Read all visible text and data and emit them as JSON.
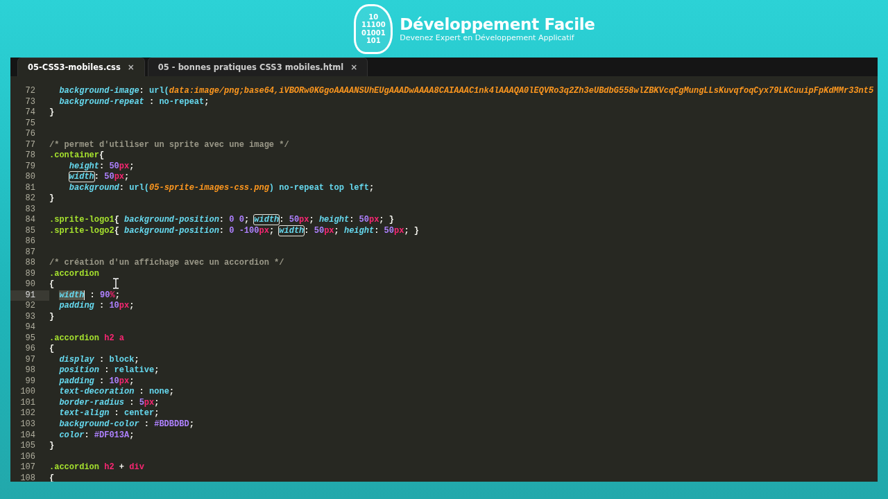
{
  "brand": {
    "logo_digits": "10\n11100\n01001\n101",
    "title": "Développement Facile",
    "tagline": "Devenez Expert en Développement Applicatif"
  },
  "tabs": [
    {
      "label": "05-CSS3-mobiles.css",
      "close": "×",
      "selected": true
    },
    {
      "label": "05 - bonnes pratiques CSS3 mobiles.html",
      "close": "×",
      "selected": false
    }
  ],
  "lines": [
    {
      "number": "72",
      "kind": "decl",
      "current": false,
      "tokens": [
        {
          "kind": "prop",
          "text": "background-image"
        },
        {
          "kind": "p",
          "text": ": "
        },
        {
          "kind": "val",
          "text": "url("
        },
        {
          "kind": "str",
          "text": "data:image/png;base64,iVBORw0KGgoAAAANSUhEUgAAADwAAAA8CAIAAAC1nk4lAAAQA0lEQVRo3q2Zh3eUBdbG558wlZBKVcqCgMungLLsKuvqfoqCyx79LKCuuipFpKdMMr33nt5"
        }
      ]
    },
    {
      "number": "73",
      "kind": "decl",
      "current": false,
      "tokens": [
        {
          "kind": "prop",
          "text": "background-repeat"
        },
        {
          "kind": "p",
          "text": " : "
        },
        {
          "kind": "val",
          "text": "no-repeat"
        },
        {
          "kind": "p",
          "text": ";"
        }
      ]
    },
    {
      "number": "74",
      "kind": "rule",
      "current": false,
      "tokens": [
        {
          "kind": "p",
          "text": "}"
        }
      ]
    },
    {
      "number": "75",
      "current": false
    },
    {
      "number": "76",
      "current": false
    },
    {
      "number": "77",
      "kind": "rule",
      "current": false,
      "tokens": [
        {
          "kind": "com",
          "text": "/* permet d'utiliser un sprite avec une image */"
        }
      ]
    },
    {
      "number": "78",
      "kind": "rule",
      "current": false,
      "tokens": [
        {
          "kind": "sel",
          "text": ".container"
        },
        {
          "kind": "p",
          "text": "{"
        }
      ]
    },
    {
      "number": "79",
      "kind": "nested",
      "current": false,
      "tokens": [
        {
          "kind": "prop",
          "text": "height"
        },
        {
          "kind": "p",
          "text": ": "
        },
        {
          "kind": "num",
          "text": "50"
        },
        {
          "kind": "unit",
          "text": "px"
        },
        {
          "kind": "p",
          "text": ";"
        }
      ]
    },
    {
      "number": "80",
      "kind": "nested",
      "current": false,
      "tokens": [
        {
          "kind": "prop",
          "text": "width",
          "boxed": true
        },
        {
          "kind": "p",
          "text": ": "
        },
        {
          "kind": "num",
          "text": "50"
        },
        {
          "kind": "unit",
          "text": "px"
        },
        {
          "kind": "p",
          "text": ";"
        }
      ]
    },
    {
      "number": "81",
      "kind": "nested",
      "current": false,
      "tokens": [
        {
          "kind": "prop",
          "text": "background"
        },
        {
          "kind": "p",
          "text": ": "
        },
        {
          "kind": "val",
          "text": "url("
        },
        {
          "kind": "str",
          "text": "05-sprite-images-css.png"
        },
        {
          "kind": "val",
          "text": ") no-repeat top left"
        },
        {
          "kind": "p",
          "text": ";"
        }
      ]
    },
    {
      "number": "82",
      "kind": "rule",
      "current": false,
      "tokens": [
        {
          "kind": "p",
          "text": "}"
        }
      ]
    },
    {
      "number": "83",
      "current": false
    },
    {
      "number": "84",
      "kind": "rule",
      "current": false,
      "tokens": [
        {
          "kind": "sel",
          "text": ".sprite-logo1"
        },
        {
          "kind": "p",
          "text": "{ "
        },
        {
          "kind": "prop",
          "text": "background-position"
        },
        {
          "kind": "p",
          "text": ": "
        },
        {
          "kind": "num",
          "text": "0 0"
        },
        {
          "kind": "p",
          "text": "; "
        },
        {
          "kind": "prop",
          "text": "width",
          "boxed": true
        },
        {
          "kind": "p",
          "text": ": "
        },
        {
          "kind": "num",
          "text": "50"
        },
        {
          "kind": "unit",
          "text": "px"
        },
        {
          "kind": "p",
          "text": "; "
        },
        {
          "kind": "prop",
          "text": "height"
        },
        {
          "kind": "p",
          "text": ": "
        },
        {
          "kind": "num",
          "text": "50"
        },
        {
          "kind": "unit",
          "text": "px"
        },
        {
          "kind": "p",
          "text": "; }"
        }
      ]
    },
    {
      "number": "85",
      "kind": "rule",
      "current": false,
      "tokens": [
        {
          "kind": "sel",
          "text": ".sprite-logo2"
        },
        {
          "kind": "p",
          "text": "{ "
        },
        {
          "kind": "prop",
          "text": "background-position"
        },
        {
          "kind": "p",
          "text": ": "
        },
        {
          "kind": "num",
          "text": "0 -100"
        },
        {
          "kind": "unit",
          "text": "px"
        },
        {
          "kind": "p",
          "text": "; "
        },
        {
          "kind": "prop",
          "text": "width",
          "boxed": true
        },
        {
          "kind": "p",
          "text": ": "
        },
        {
          "kind": "num",
          "text": "50"
        },
        {
          "kind": "unit",
          "text": "px"
        },
        {
          "kind": "p",
          "text": "; "
        },
        {
          "kind": "prop",
          "text": "height"
        },
        {
          "kind": "p",
          "text": ": "
        },
        {
          "kind": "num",
          "text": "50"
        },
        {
          "kind": "unit",
          "text": "px"
        },
        {
          "kind": "p",
          "text": "; }"
        }
      ]
    },
    {
      "number": "86",
      "current": false
    },
    {
      "number": "87",
      "current": false
    },
    {
      "number": "88",
      "kind": "rule",
      "current": false,
      "tokens": [
        {
          "kind": "com",
          "text": "/* création d'un affichage avec un accordion */"
        }
      ]
    },
    {
      "number": "89",
      "kind": "rule",
      "current": false,
      "tokens": [
        {
          "kind": "sel",
          "text": ".accordion"
        }
      ]
    },
    {
      "number": "90",
      "kind": "rule",
      "current": false,
      "tokens": [
        {
          "kind": "p",
          "text": "{"
        }
      ]
    },
    {
      "number": "91",
      "kind": "decl",
      "current": true,
      "tokens": [
        {
          "kind": "prop",
          "text": "width",
          "selected": true
        },
        {
          "kind": "p",
          "text": " : "
        },
        {
          "kind": "num",
          "text": "90"
        },
        {
          "kind": "unit",
          "text": "%"
        },
        {
          "kind": "p",
          "text": ";"
        }
      ]
    },
    {
      "number": "92",
      "kind": "decl",
      "current": false,
      "tokens": [
        {
          "kind": "prop",
          "text": "padding"
        },
        {
          "kind": "p",
          "text": " : "
        },
        {
          "kind": "num",
          "text": "10"
        },
        {
          "kind": "unit",
          "text": "px"
        },
        {
          "kind": "p",
          "text": ";"
        }
      ]
    },
    {
      "number": "93",
      "kind": "rule",
      "current": false,
      "tokens": [
        {
          "kind": "p",
          "text": "}"
        }
      ]
    },
    {
      "number": "94",
      "current": false
    },
    {
      "number": "95",
      "kind": "rule",
      "current": false,
      "tokens": [
        {
          "kind": "sel",
          "text": ".accordion "
        },
        {
          "kind": "tag",
          "text": "h2 a"
        }
      ]
    },
    {
      "number": "96",
      "kind": "rule",
      "current": false,
      "tokens": [
        {
          "kind": "p",
          "text": "{"
        }
      ]
    },
    {
      "number": "97",
      "kind": "decl",
      "current": false,
      "tokens": [
        {
          "kind": "prop",
          "text": "display"
        },
        {
          "kind": "p",
          "text": " : "
        },
        {
          "kind": "val",
          "text": "block"
        },
        {
          "kind": "p",
          "text": ";"
        }
      ]
    },
    {
      "number": "98",
      "kind": "decl",
      "current": false,
      "tokens": [
        {
          "kind": "prop",
          "text": "position"
        },
        {
          "kind": "p",
          "text": " : "
        },
        {
          "kind": "val",
          "text": "relative"
        },
        {
          "kind": "p",
          "text": ";"
        }
      ]
    },
    {
      "number": "99",
      "kind": "decl",
      "current": false,
      "tokens": [
        {
          "kind": "prop",
          "text": "padding"
        },
        {
          "kind": "p",
          "text": " : "
        },
        {
          "kind": "num",
          "text": "10"
        },
        {
          "kind": "unit",
          "text": "px"
        },
        {
          "kind": "p",
          "text": ";"
        }
      ]
    },
    {
      "number": "100",
      "kind": "decl",
      "current": false,
      "tokens": [
        {
          "kind": "prop",
          "text": "text-decoration"
        },
        {
          "kind": "p",
          "text": " : "
        },
        {
          "kind": "val",
          "text": "none"
        },
        {
          "kind": "p",
          "text": ";"
        }
      ]
    },
    {
      "number": "101",
      "kind": "decl",
      "current": false,
      "tokens": [
        {
          "kind": "prop",
          "text": "border-radius"
        },
        {
          "kind": "p",
          "text": " : "
        },
        {
          "kind": "num",
          "text": "5"
        },
        {
          "kind": "unit",
          "text": "px"
        },
        {
          "kind": "p",
          "text": ";"
        }
      ]
    },
    {
      "number": "102",
      "kind": "decl",
      "current": false,
      "tokens": [
        {
          "kind": "prop",
          "text": "text-align"
        },
        {
          "kind": "p",
          "text": " : "
        },
        {
          "kind": "val",
          "text": "center"
        },
        {
          "kind": "p",
          "text": ";"
        }
      ]
    },
    {
      "number": "103",
      "kind": "decl",
      "current": false,
      "tokens": [
        {
          "kind": "prop",
          "text": "background-color"
        },
        {
          "kind": "p",
          "text": " : "
        },
        {
          "kind": "num",
          "text": "#BDBDBD"
        },
        {
          "kind": "p",
          "text": ";"
        }
      ]
    },
    {
      "number": "104",
      "kind": "decl",
      "current": false,
      "tokens": [
        {
          "kind": "prop",
          "text": "color"
        },
        {
          "kind": "p",
          "text": ": "
        },
        {
          "kind": "num",
          "text": "#DF013A"
        },
        {
          "kind": "p",
          "text": ";"
        }
      ]
    },
    {
      "number": "105",
      "kind": "rule",
      "current": false,
      "tokens": [
        {
          "kind": "p",
          "text": "}"
        }
      ]
    },
    {
      "number": "106",
      "current": false
    },
    {
      "number": "107",
      "kind": "rule",
      "current": false,
      "tokens": [
        {
          "kind": "sel",
          "text": ".accordion "
        },
        {
          "kind": "tag",
          "text": "h2"
        },
        {
          "kind": "p",
          "text": " + "
        },
        {
          "kind": "tag",
          "text": "div"
        }
      ]
    },
    {
      "number": "108",
      "kind": "rule",
      "current": false,
      "tokens": [
        {
          "kind": "p",
          "text": "{"
        }
      ]
    }
  ]
}
